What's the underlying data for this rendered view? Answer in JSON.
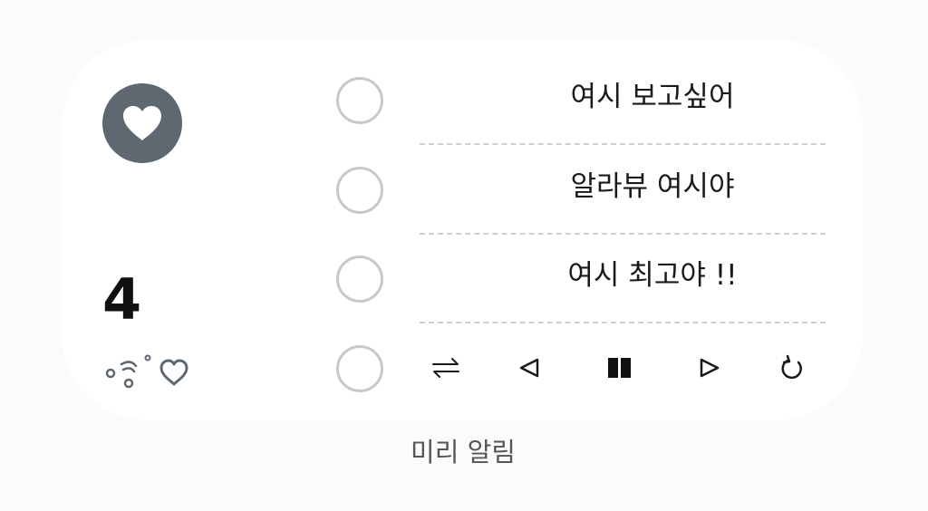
{
  "widget": {
    "count": "4",
    "heart_icon": "heart-icon",
    "accent_color": "#5f6870"
  },
  "todos": [
    {
      "text": "여시 보고싶어",
      "checked": false
    },
    {
      "text": "알라뷰 여시야",
      "checked": false
    },
    {
      "text": "여시 최고야 !!",
      "checked": false
    },
    {
      "checked": false
    }
  ],
  "player_controls": [
    {
      "name": "repeat-swap-icon"
    },
    {
      "name": "previous-icon"
    },
    {
      "name": "pause-icon"
    },
    {
      "name": "next-icon"
    },
    {
      "name": "refresh-icon"
    }
  ],
  "caption": "미리 알림"
}
